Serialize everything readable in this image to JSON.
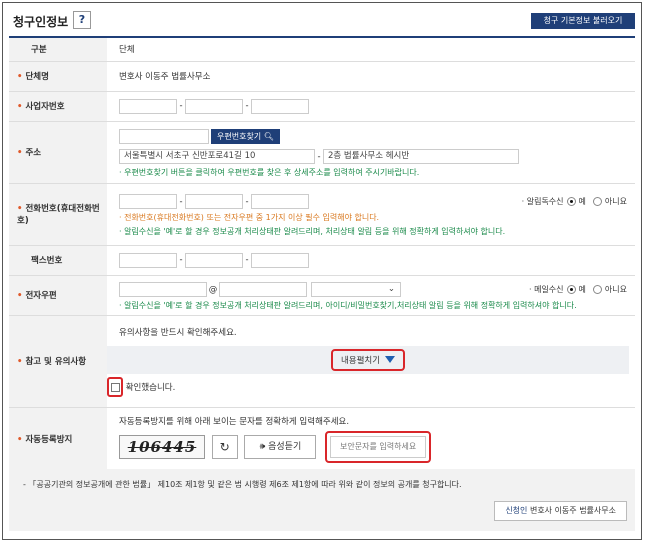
{
  "header": {
    "title": "청구인정보",
    "help_label": "?",
    "load_button": "청구 기본정보 불러오기"
  },
  "rows": {
    "category": {
      "label": "구분",
      "value": "단체"
    },
    "org_name": {
      "label": "단체명",
      "value": "변호사 이동주 법률사무소"
    },
    "biz_number": {
      "label": "사업자번호"
    },
    "address": {
      "label": "주소",
      "zip_button": "우편번호찾기",
      "addr1": "서울특별시 서초구 신반포로41길 10",
      "addr2": "2층 법률사무소 헤시반",
      "note": "· 우편번호찾기 버튼을 클릭하여 우편번호를 찾은 후 상세주소를 입력하여 주시기바랍니다."
    },
    "phone": {
      "label": "전화번호(휴대전화번호)",
      "notify_label": "· 알림독수신",
      "yes": "예",
      "no": "아니요",
      "note_orange": "· 전화번호(휴대전화번호) 또는 전자우편 중 1가지 이상 필수 입력해야 합니다.",
      "note_green": "· 알림수신을 '예'로 할 경우 정보공개 처리상태판 알려드리며, 처리상태 알림 등을 위해 정확하게 입력하셔야 합니다."
    },
    "fax": {
      "label": "팩스번호"
    },
    "email": {
      "label": "전자우편",
      "at": "@",
      "notify_label": "· 메일수신",
      "yes": "예",
      "no": "아니요",
      "note": "· 알림수신을 '예'로 할 경우 정보공개 처리상태판 알려드리며, 아이디/비밀번호찾기,처리상태 알림 등을 위해 정확하게 입력하셔야 합니다."
    },
    "notice": {
      "label": "참고 및 유의사항",
      "intro": "유의사항을 반드시 확인해주세요.",
      "expand_button": "내용펼치기",
      "confirm_label": "확인했습니다."
    },
    "captcha": {
      "label": "자동등록방지",
      "intro": "자동등록방지를 위해 아래 보이는 문자를 정확하게 입력해주세요.",
      "code": "106445",
      "refresh_icon": "↻",
      "audio_label": "음성듣기",
      "input_placeholder": "보안문자를 입력하세요"
    }
  },
  "footer": {
    "text": "- 「공공기관의 정보공개에 관한 법률」 제10조 제1항 및 같은 법 시행령 제6조 제1항에 따라 위와 같이 정보의 공개를 청구합니다.",
    "signer_prefix": "신청인",
    "signer_name": "변호사 이동주 법률사무소"
  },
  "colors": {
    "brand": "#1f3f78",
    "required": "#e05a2b",
    "highlight": "#d9262a",
    "note_green": "#1a8a4a",
    "note_orange": "#d9781f"
  }
}
